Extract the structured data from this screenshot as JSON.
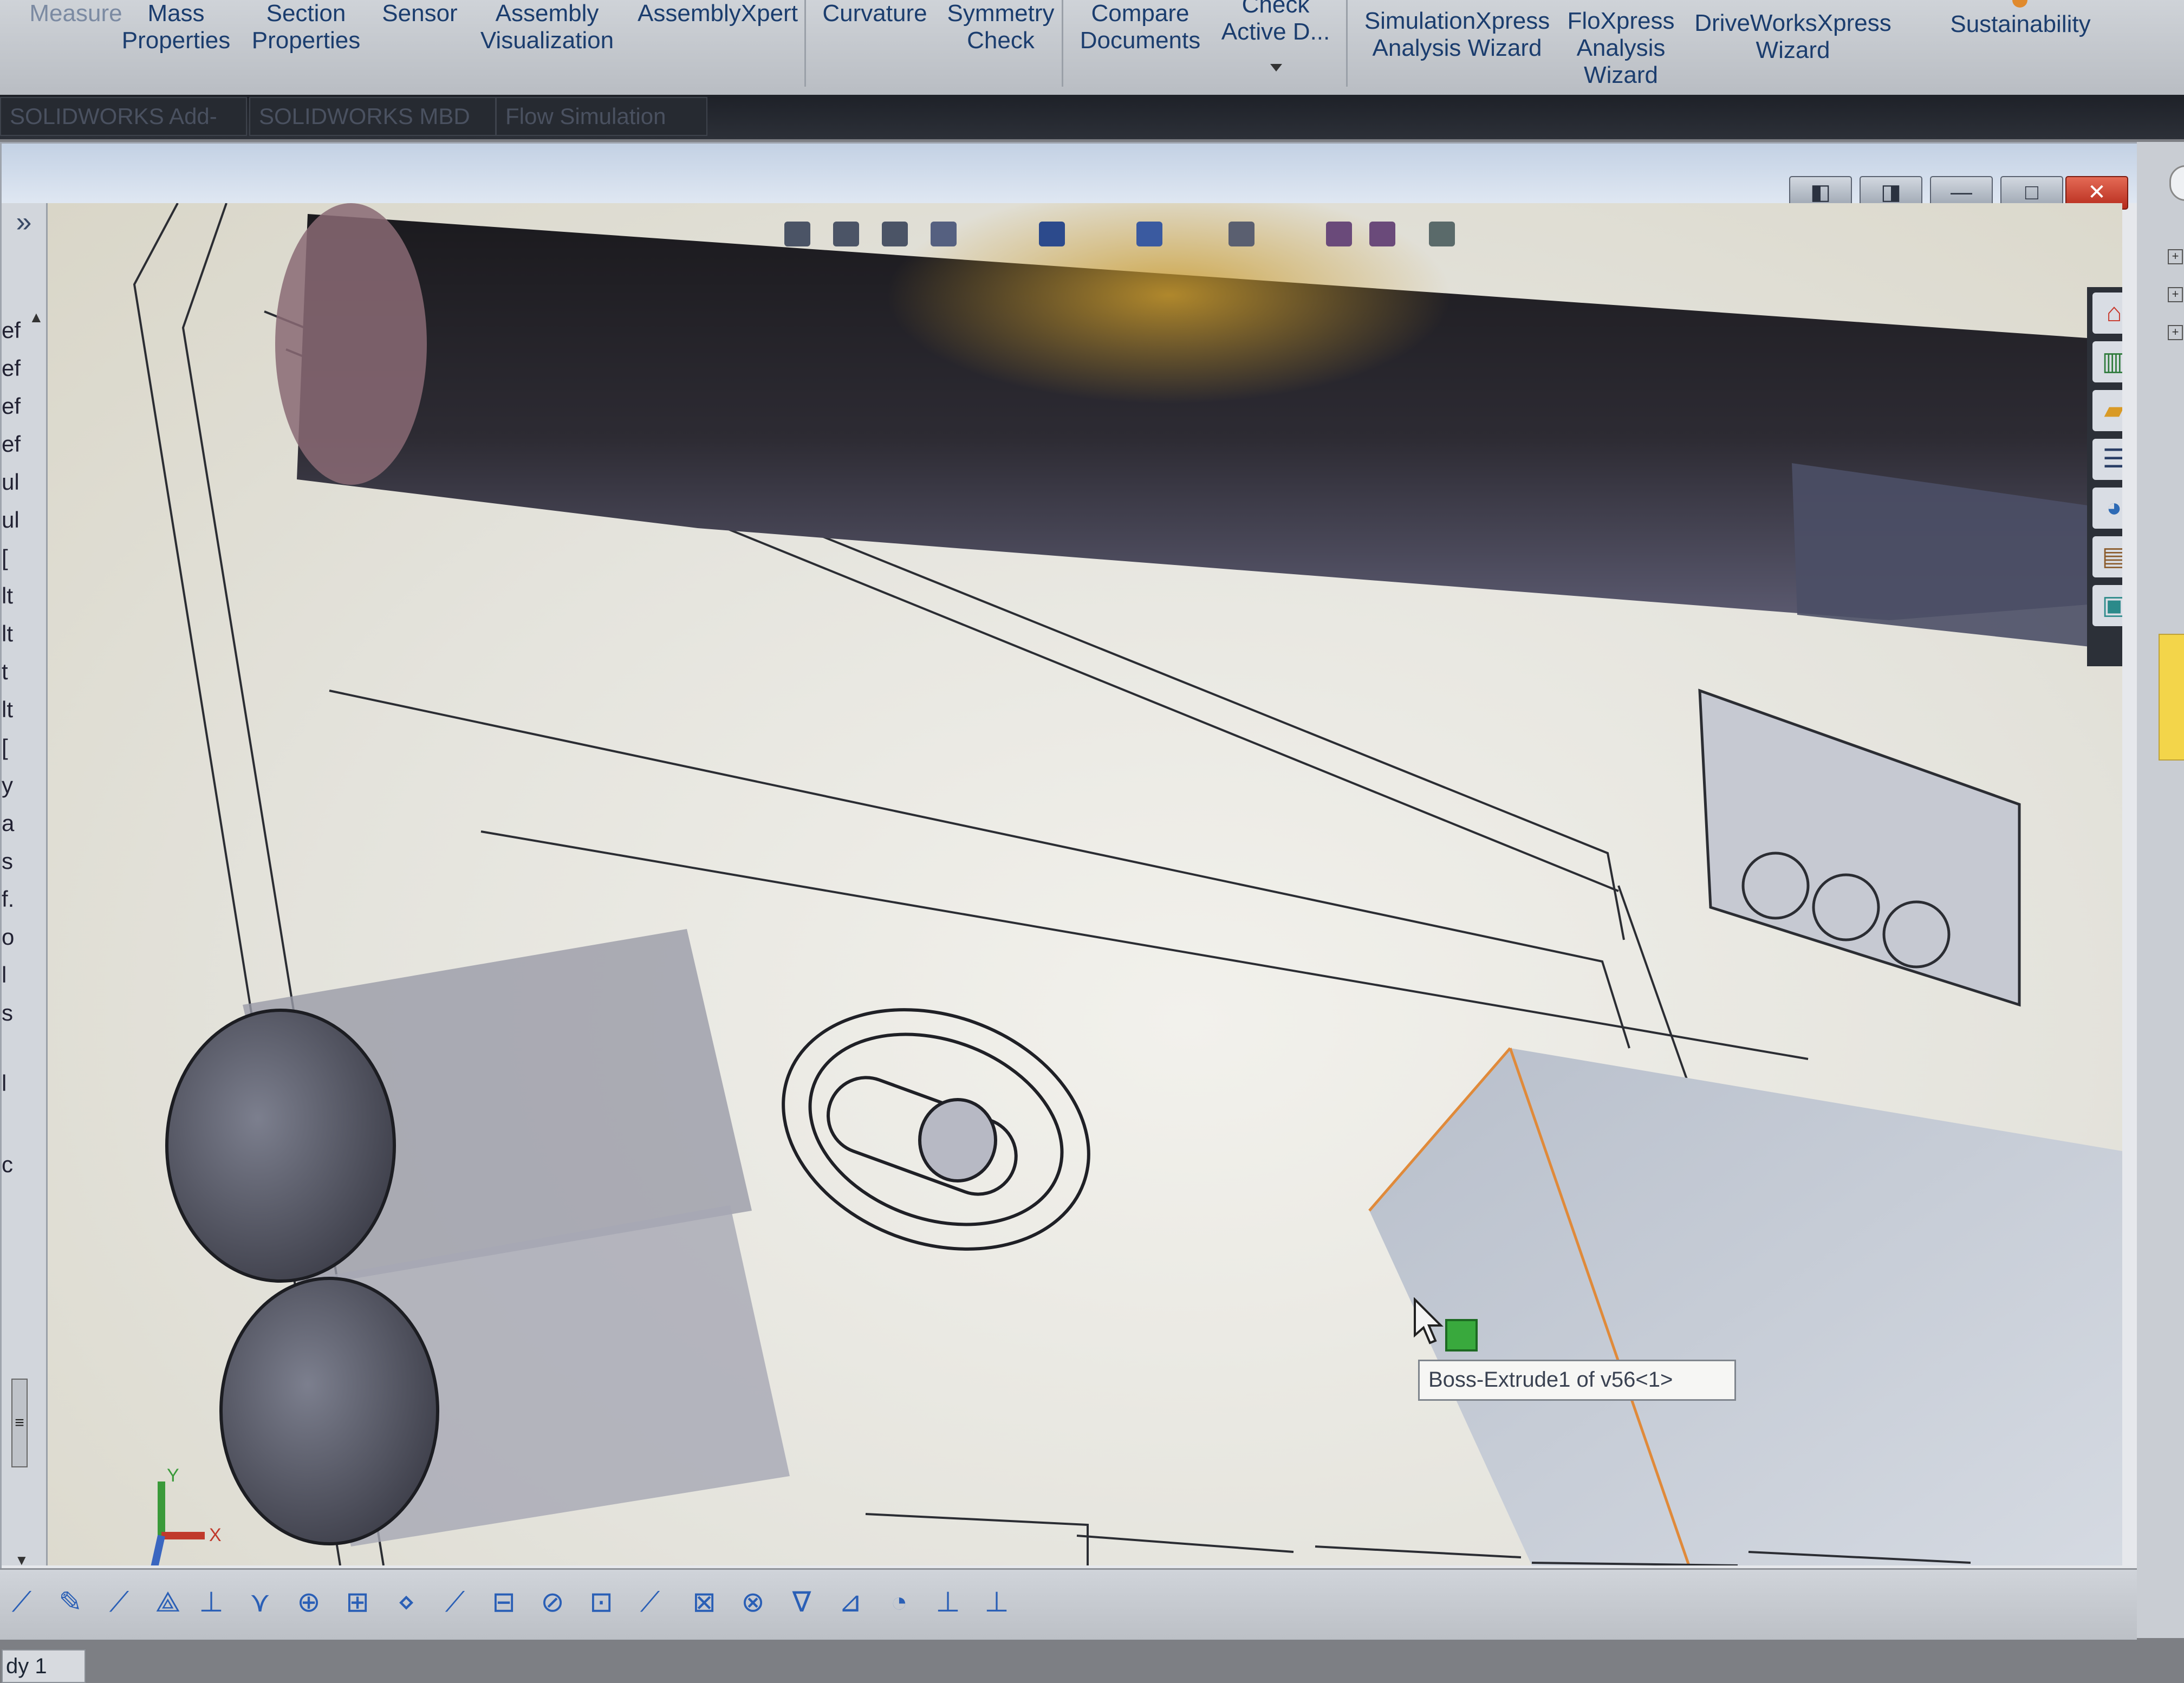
{
  "ribbon": {
    "buttons": [
      {
        "id": "measure",
        "label": "Measure"
      },
      {
        "id": "mass_properties",
        "label": "Mass\nProperties"
      },
      {
        "id": "section_properties",
        "label": "Section\nProperties"
      },
      {
        "id": "sensor",
        "label": "Sensor"
      },
      {
        "id": "assembly_visualization",
        "label": "Assembly\nVisualization"
      },
      {
        "id": "assemblyxpert",
        "label": "AssemblyXpert"
      },
      {
        "id": "curvature",
        "label": "Curvature"
      },
      {
        "id": "symmetry_check",
        "label": "Symmetry\nCheck"
      },
      {
        "id": "compare_documents",
        "label": "Compare\nDocuments"
      },
      {
        "id": "check_active_document",
        "label": "Check\nActive D..."
      },
      {
        "id": "simulationxpress",
        "label": "SimulationXpress\nAnalysis Wizard"
      },
      {
        "id": "floxpress",
        "label": "FloXpress\nAnalysis\nWizard"
      },
      {
        "id": "driveworksxpress",
        "label": "DriveWorksXpress\nWizard"
      },
      {
        "id": "sustainability",
        "label": "Sustainability"
      }
    ]
  },
  "command_tabs": [
    {
      "label": "SOLIDWORKS Add-Ins"
    },
    {
      "label": "SOLIDWORKS MBD"
    },
    {
      "label": "Flow Simulation"
    }
  ],
  "feature_tree": {
    "rows": [
      "ef",
      "ef",
      "ef",
      "ef",
      "ul",
      "ul",
      "[",
      "lt",
      "lt",
      "t",
      "lt",
      "[",
      "y",
      "a",
      "s",
      "f.",
      "o",
      "l",
      "s",
      "l",
      "c"
    ]
  },
  "viewport": {
    "tooltip": "Boss-Extrude1 of v56<1>",
    "triad_axes": {
      "x": "X",
      "y": "Y",
      "z": "Z"
    }
  },
  "model_tab": {
    "label": "dy 1"
  },
  "window_controls": [
    "◧",
    "◨",
    "—",
    "□",
    "✕"
  ],
  "icons": {
    "home": "home-icon",
    "resources": "resources-icon",
    "design_library": "folder-icon",
    "file_explorer": "file-explorer-icon",
    "view_palette": "view-palette-icon",
    "appearances": "appearances-icon",
    "custom_properties": "custom-properties-icon"
  },
  "colors": {
    "ribbon_text": "#1b3d6e",
    "selected_edge": "#e08a3a",
    "selection_marker": "#39a93d",
    "close_button": "#c8372a"
  }
}
